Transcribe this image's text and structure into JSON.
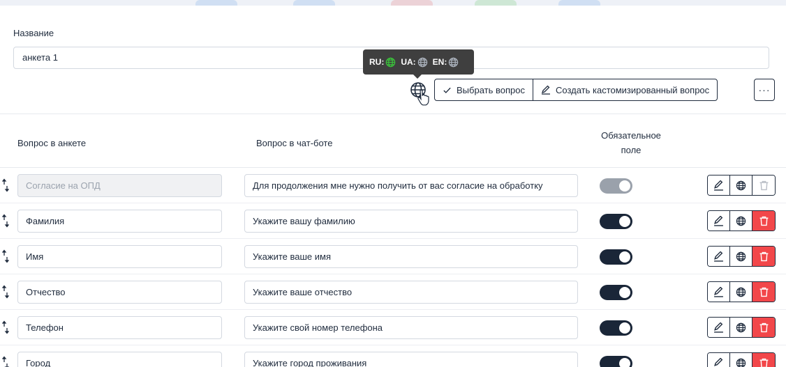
{
  "form": {
    "name_label": "Название",
    "name_value": "анкета 1"
  },
  "tooltip": {
    "langs": [
      {
        "code": "RU:",
        "color": "#3bbf3b",
        "icon": "globe-icon"
      },
      {
        "code": "UA:",
        "color": "#a9b0ba",
        "icon": "globe-icon"
      },
      {
        "code": "EN:",
        "color": "#a9b0ba",
        "icon": "globe-icon"
      }
    ]
  },
  "toolbar": {
    "select_label": "Выбрать вопрос",
    "create_label": "Создать кастомизированный вопрос",
    "more_label": "···"
  },
  "table": {
    "headers": {
      "questionnaire": "Вопрос в анкете",
      "chatbot": "Вопрос в чат-боте",
      "required_line1": "Обязательное",
      "required_line2": "поле"
    },
    "rows": [
      {
        "question": "Согласие на ОПД",
        "chatbot": "Для продолжения мне нужно получить от вас согласие на обработку",
        "required": true,
        "locked": true
      },
      {
        "question": "Фамилия",
        "chatbot": "Укажите вашу фамилию",
        "required": true,
        "locked": false
      },
      {
        "question": "Имя",
        "chatbot": "Укажите ваше имя",
        "required": true,
        "locked": false
      },
      {
        "question": "Отчество",
        "chatbot": "Укажите ваше отчество",
        "required": true,
        "locked": false
      },
      {
        "question": "Телефон",
        "chatbot": "Укажите свой номер телефона",
        "required": true,
        "locked": false
      },
      {
        "question": "Город",
        "chatbot": "Укажите город проживания",
        "required": true,
        "locked": false
      }
    ]
  },
  "colors": {
    "primary": "#1a2638",
    "danger": "#f2474a",
    "active_lang": "#3bbf3b"
  }
}
